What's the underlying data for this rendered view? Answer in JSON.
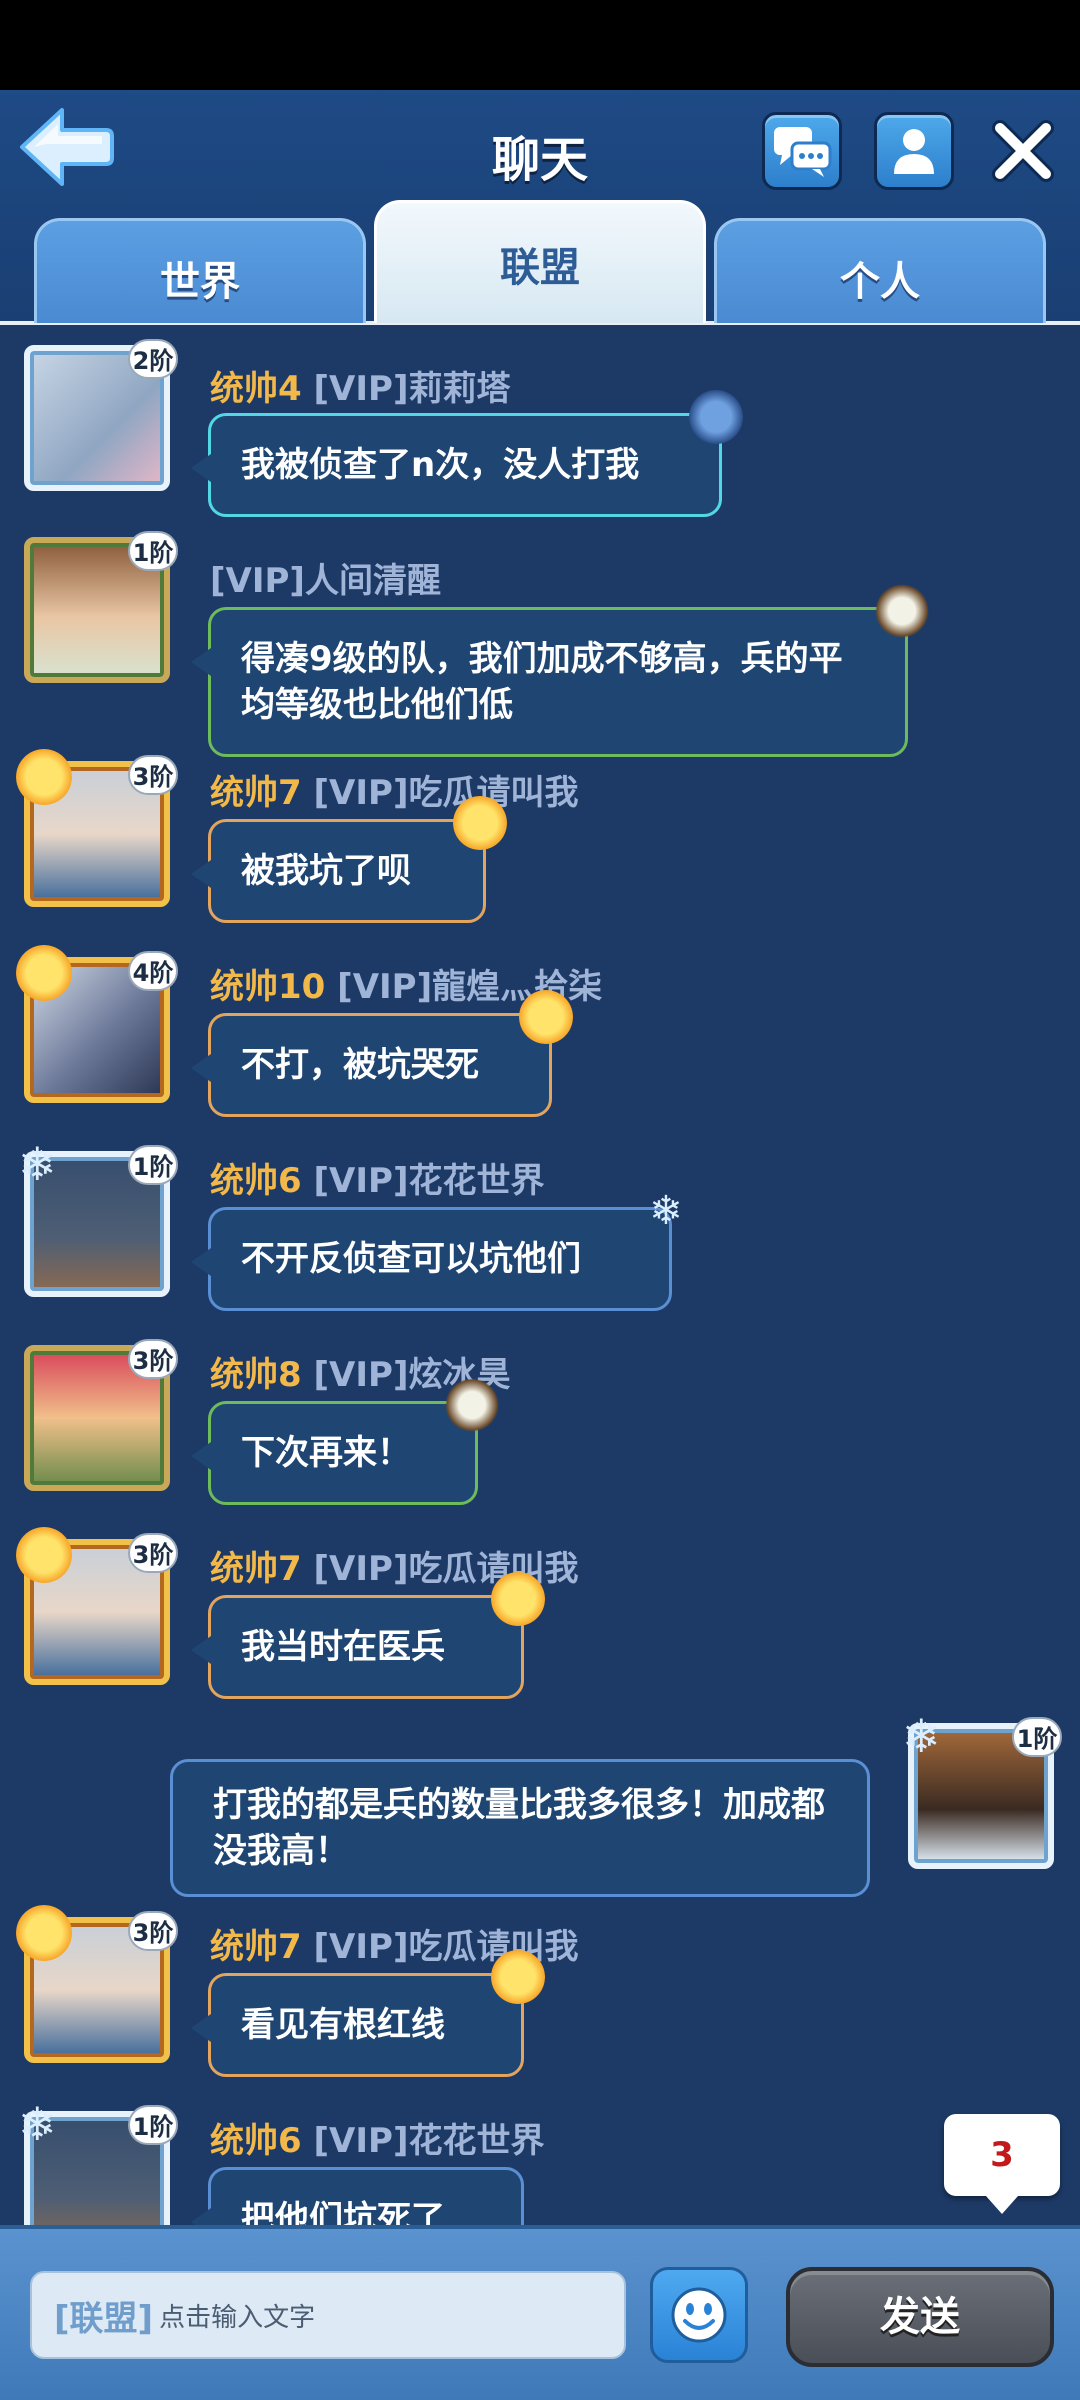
{
  "header": {
    "title": "聊天"
  },
  "tabs": [
    {
      "label": "世界"
    },
    {
      "label": "联盟"
    },
    {
      "label": "个人"
    }
  ],
  "messages": [
    {
      "rank": "2阶",
      "level": "统帅4",
      "name": "[VIP]莉莉塔",
      "text": "我被侦查了n次，没人打我"
    },
    {
      "rank": "1阶",
      "level": "",
      "name": "[VIP]人间清醒",
      "text": "得凑9级的队，我们加成不够高，兵的平均等级也比他们低"
    },
    {
      "rank": "3阶",
      "level": "统帅7",
      "name": "[VIP]吃瓜请叫我",
      "text": "被我坑了呗"
    },
    {
      "rank": "4阶",
      "level": "统帅10",
      "name": "[VIP]龍煌灬拾柒",
      "text": "不打，被坑哭死"
    },
    {
      "rank": "1阶",
      "level": "统帅6",
      "name": "[VIP]花花世界",
      "text": "不开反侦查可以坑他们"
    },
    {
      "rank": "3阶",
      "level": "统帅8",
      "name": "[VIP]炫冰昊",
      "text": "下次再来！"
    },
    {
      "rank": "3阶",
      "level": "统帅7",
      "name": "[VIP]吃瓜请叫我",
      "text": "我当时在医兵"
    },
    {
      "rank": "1阶",
      "level": "",
      "name": "",
      "text": "打我的都是兵的数量比我多很多！加成都没我高！",
      "self": true
    },
    {
      "rank": "3阶",
      "level": "统帅7",
      "name": "[VIP]吃瓜请叫我",
      "text": "看见有根红线"
    },
    {
      "rank": "1阶",
      "level": "统帅6",
      "name": "[VIP]花花世界",
      "text": "把他们坑死了"
    }
  ],
  "unread_count": "3",
  "input": {
    "tag": "[联盟]",
    "placeholder": "点击输入文字"
  },
  "send_label": "发送",
  "icons": {
    "back": "back-arrow-icon",
    "chat": "chat-bubbles-icon",
    "profile": "person-icon",
    "close": "close-icon",
    "emoji": "smiley-icon"
  },
  "colors": {
    "background": "#1d3a67",
    "level_text": "#f2b84a",
    "name_text": "#9fb4d6",
    "badge_text": "#c21a1a"
  }
}
